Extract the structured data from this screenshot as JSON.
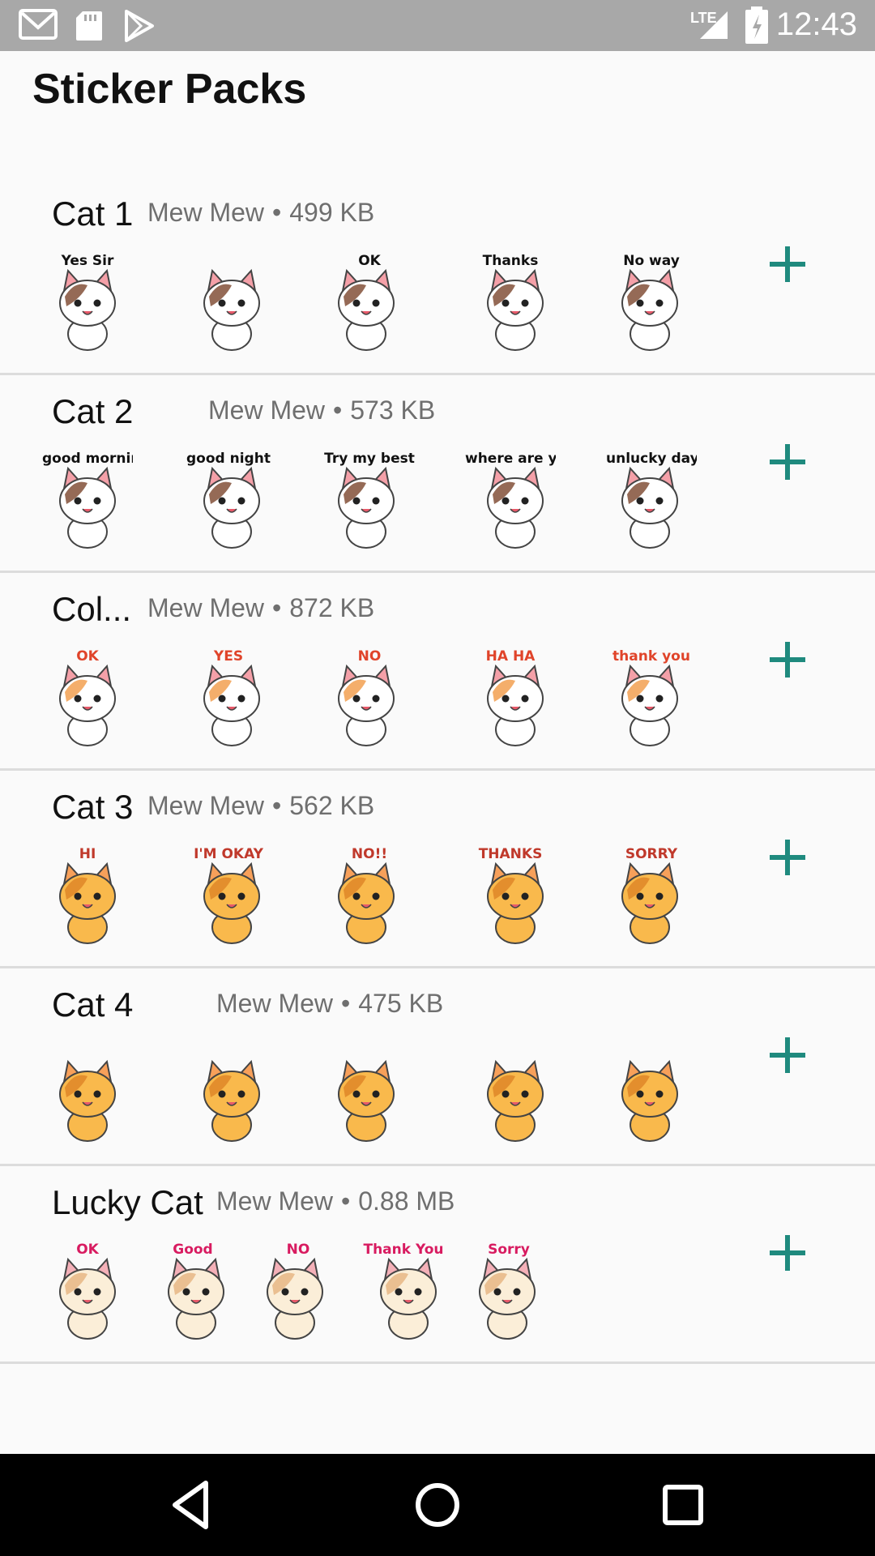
{
  "status_bar": {
    "time": "12:43",
    "network": "LTE"
  },
  "header": {
    "title": "Sticker Packs"
  },
  "packs": [
    {
      "name": "Cat 1",
      "publisher": "Mew Mew",
      "separator": "•",
      "size": "499 KB",
      "stickers": [
        {
          "caption": "Yes Sir",
          "palette": "brown"
        },
        {
          "caption": "",
          "palette": "brown"
        },
        {
          "caption": "OK",
          "palette": "brown"
        },
        {
          "caption": "Thanks",
          "palette": "brown"
        },
        {
          "caption": "No way",
          "palette": "brown"
        }
      ]
    },
    {
      "name": "Cat 2",
      "publisher": "Mew Mew",
      "separator": "•",
      "size": "573 KB",
      "stickers": [
        {
          "caption": "good morning",
          "palette": "brown"
        },
        {
          "caption": "good night",
          "palette": "brown"
        },
        {
          "caption": "Try my best",
          "palette": "brown"
        },
        {
          "caption": "where are you?",
          "palette": "brown"
        },
        {
          "caption": "unlucky day",
          "palette": "brown"
        }
      ]
    },
    {
      "name": "Col...",
      "publisher": "Mew Mew",
      "separator": "•",
      "size": "872 KB",
      "stickers": [
        {
          "caption": "OK",
          "palette": "calico"
        },
        {
          "caption": "YES",
          "palette": "calico"
        },
        {
          "caption": "NO",
          "palette": "calico"
        },
        {
          "caption": "HA HA",
          "palette": "calico"
        },
        {
          "caption": "thank you",
          "palette": "calico"
        }
      ]
    },
    {
      "name": "Cat 3",
      "publisher": "Mew Mew",
      "separator": "•",
      "size": "562 KB",
      "stickers": [
        {
          "caption": "HI",
          "palette": "orange"
        },
        {
          "caption": "I'M OKAY",
          "palette": "orange"
        },
        {
          "caption": "NO!!",
          "palette": "orange"
        },
        {
          "caption": "THANKS",
          "palette": "orange"
        },
        {
          "caption": "SORRY",
          "palette": "orange"
        }
      ]
    },
    {
      "name": "Cat 4",
      "publisher": "Mew Mew",
      "separator": "•",
      "size": "475 KB",
      "stickers": [
        {
          "caption": "",
          "palette": "orange"
        },
        {
          "caption": "",
          "palette": "orange"
        },
        {
          "caption": "",
          "palette": "orange"
        },
        {
          "caption": "",
          "palette": "orange"
        },
        {
          "caption": "",
          "palette": "orange"
        }
      ]
    },
    {
      "name": "Lucky Cat",
      "publisher": "Mew Mew",
      "separator": "•",
      "size": "0.88 MB",
      "stickers": [
        {
          "caption": "OK",
          "palette": "cream"
        },
        {
          "caption": "Good",
          "palette": "cream"
        },
        {
          "caption": "NO",
          "palette": "cream"
        },
        {
          "caption": "Thank You",
          "palette": "cream"
        },
        {
          "caption": "Sorry",
          "palette": "cream"
        }
      ]
    }
  ],
  "palettes": {
    "brown": {
      "head": "#ffffff",
      "patch": "#8a5a44",
      "ear": "#f4a0a8",
      "accent": "#111111"
    },
    "calico": {
      "head": "#ffffff",
      "patch": "#f3a55b",
      "ear": "#f4a0a8",
      "accent": "#e0442a"
    },
    "orange": {
      "head": "#f9b94c",
      "patch": "#e08a2a",
      "ear": "#f7a05a",
      "accent": "#c0392b"
    },
    "cream": {
      "head": "#fbeed8",
      "patch": "#e8b98a",
      "ear": "#f4b0b8",
      "accent": "#d81b60"
    }
  },
  "colors": {
    "accent": "#1f8a7e",
    "divider": "#dcdcdc",
    "meta_text": "#6f6f6f"
  },
  "icons": {
    "status_left": [
      "gmail-icon",
      "sd-card-icon",
      "play-store-icon"
    ],
    "status_right": [
      "signal-icon",
      "battery-icon"
    ],
    "add": "plus-icon",
    "nav": [
      "back-icon",
      "home-icon",
      "recents-icon"
    ]
  }
}
